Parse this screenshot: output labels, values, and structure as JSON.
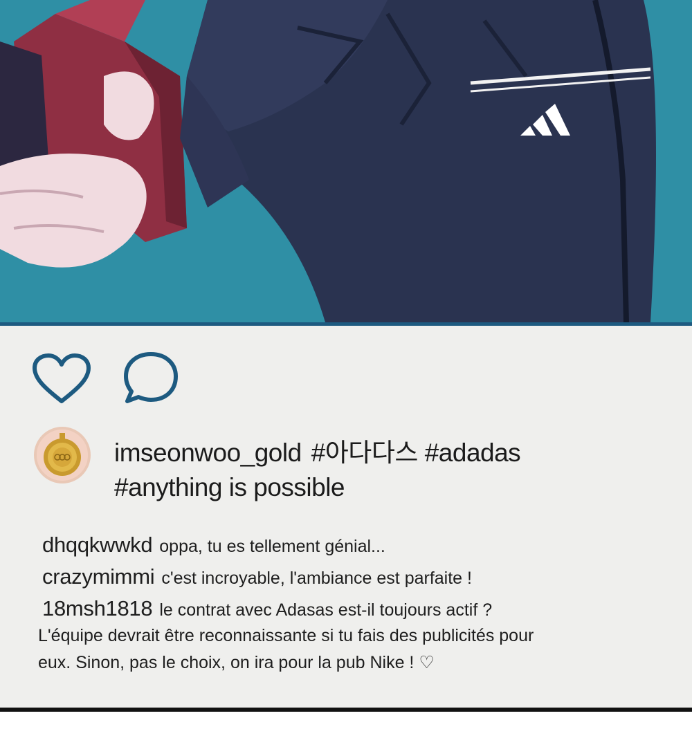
{
  "post": {
    "username": "imseonwoo_gold",
    "caption_line1": "#아다다스 #adadas",
    "caption_line2": "#anything is possible",
    "colors": {
      "photo_background": "#2f8fa5",
      "accent_blue": "#1d5a80",
      "card_background": "#efefed"
    }
  },
  "actions": {
    "like_icon": "heart-outline-icon",
    "comment_icon": "speech-bubble-icon"
  },
  "comments": [
    {
      "user": "dhqqkwwkd",
      "text": "oppa, tu es tellement génial..."
    },
    {
      "user": "crazymimmi",
      "text": "c'est incroyable, l'ambiance est parfaite !"
    },
    {
      "user": "18msh1818",
      "text": "le contrat avec Adasas est-il toujours actif ?"
    }
  ],
  "comment_continuation": {
    "line1": "L'équipe devrait être reconnaissante si tu fais des publicités pour",
    "line2": "eux. Sinon, pas le choix, on ira pour la pub Nike ! ♡"
  }
}
